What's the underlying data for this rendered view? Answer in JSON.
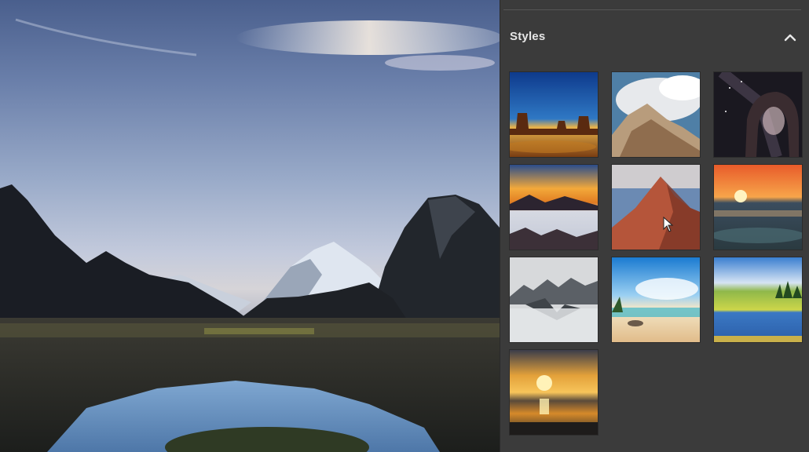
{
  "canvas": {
    "image": "mountain-lake-sunset-photo"
  },
  "styles_panel": {
    "title": "Styles",
    "collapse_icon": "chevron-up-icon",
    "thumbnails": [
      {
        "name": "desert-buttes-blue-sky"
      },
      {
        "name": "clouds-over-rocks"
      },
      {
        "name": "night-sky-arch"
      },
      {
        "name": "orange-sunset-mountains"
      },
      {
        "name": "red-rock-peak"
      },
      {
        "name": "sunset-over-sea"
      },
      {
        "name": "misty-mountains"
      },
      {
        "name": "tropical-beach"
      },
      {
        "name": "green-lake-meadow"
      },
      {
        "name": "golden-sun-reflection"
      }
    ]
  },
  "colors": {
    "panel_bg": "#3b3b3b",
    "title_text": "#e6e6e6"
  }
}
